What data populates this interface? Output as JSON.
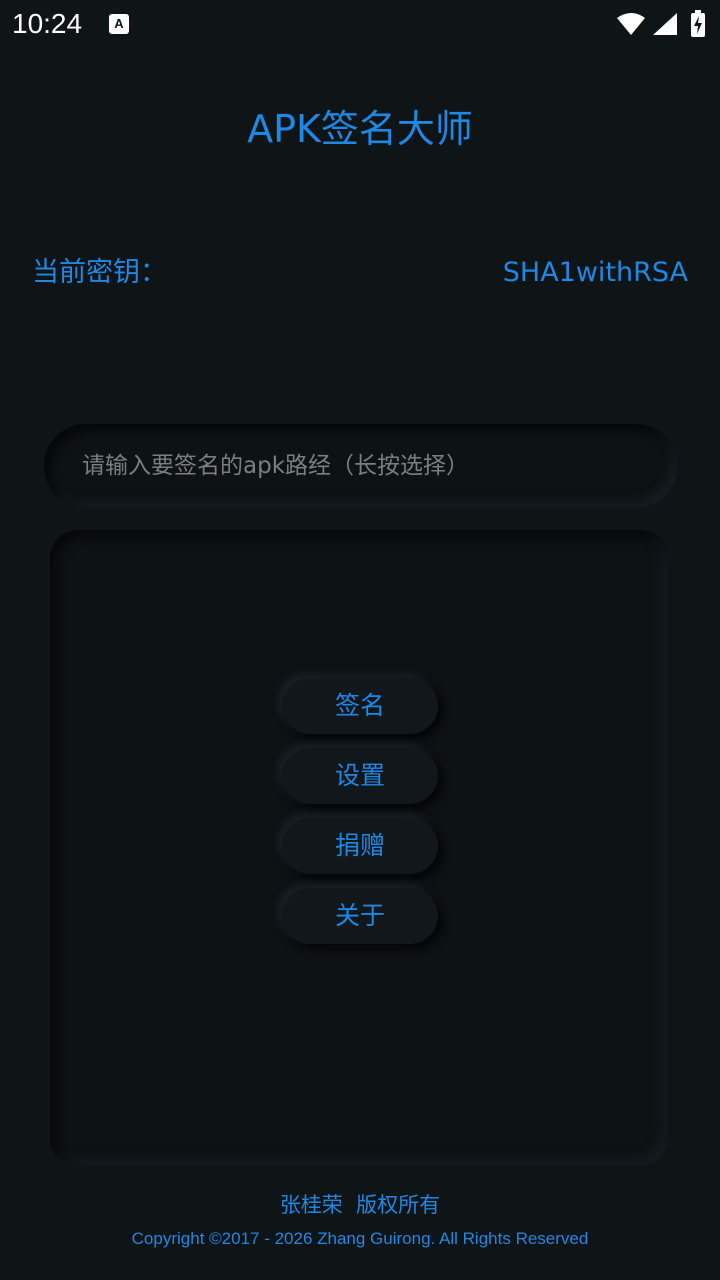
{
  "status_bar": {
    "time": "10:24",
    "notification_icon_letter": "A",
    "icons": [
      "wifi-icon",
      "signal-icon",
      "battery-charging-icon"
    ]
  },
  "app": {
    "title": "APK签名大师"
  },
  "key": {
    "label": "当前密钥：",
    "value": "SHA1withRSA"
  },
  "apk_path": {
    "placeholder": "请输入要签名的apk路经（长按选择）",
    "value": ""
  },
  "actions": {
    "sign": "签名",
    "settings": "设置",
    "donate": "捐赠",
    "about": "关于"
  },
  "footer": {
    "owner": "张桂荣  版权所有",
    "copyright": "Copyright ©2017 - 2026 Zhang Guirong. All Rights Reserved"
  },
  "colors": {
    "background": "#0f1416",
    "accent": "#1e88e5",
    "placeholder": "#7b7f82"
  }
}
